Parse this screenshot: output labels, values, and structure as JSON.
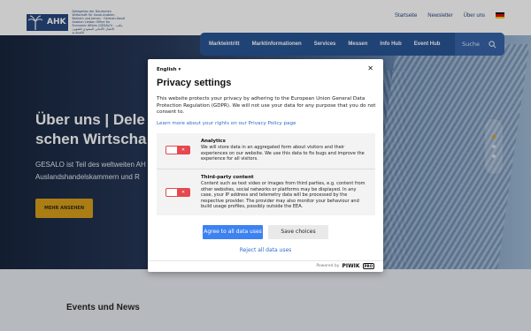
{
  "header": {
    "logo_abbr": "AHK",
    "logo_text": "Delegation der Deutschen Wirtschaft für Saudi-Arabien, Bahrain und Jemen · German-Saudi Arabian Liaison Office for Economic Affairs (GESALO) · مكتب الاتصال الألماني السعودي للشؤون الاقتصادية",
    "links": [
      "Startseite",
      "Newsletter",
      "Über uns"
    ],
    "flag_colors": [
      "#000000",
      "#dd0000",
      "#ffce00"
    ]
  },
  "nav": {
    "items": [
      "Markteintritt",
      "Marktinformationen",
      "Services",
      "Messen",
      "Info Hub",
      "Event Hub"
    ],
    "search_label": "Suche"
  },
  "hero": {
    "title_line1": "Über uns | Dele",
    "title_line2": "schen Wirtscha",
    "text_line1": "GESALO ist Teil des weltweiten AH",
    "text_line2": "Auslandshandelskammern und R",
    "button_label": "MEHR ANSEHEN"
  },
  "events_title": "Events und News",
  "modal": {
    "language": "English",
    "language_chevron": "▾",
    "close": "✕",
    "title": "Privacy settings",
    "description": "This website protects your privacy by adhering to the European Union General Data Protection Regulation (GDPR). We will not use your data for any purpose that you do not consent to.",
    "rights_link": "Learn more about your rights on our Privacy Policy page",
    "settings": [
      {
        "title": "Analytics",
        "text": "We will store data in an aggregated form about visitors and their experiences on our website. We use this data to fix bugs and improve the experience for all visitors.",
        "toggle": "✕"
      },
      {
        "title": "Third-party content",
        "text": "Content such as text video or images from third parties, e.g. content from other websites, social networks or platforms may be displayed. In any case, your IP address and telemetry data will be processed by the respective provider. The provider may also monitor your behaviour and build usage profiles, possibly outside the EEA.",
        "toggle": "✕"
      }
    ],
    "agree_button": "Agree to all data uses",
    "save_button": "Save choices",
    "reject_link": "Reject all data uses",
    "powered_by": "Powered by",
    "brand": "PIWIK",
    "brand_badge": "PRO"
  },
  "colors": {
    "brand_blue": "#1e4d91",
    "accent_gold": "#d69a0f",
    "primary_button": "#3d82f0",
    "toggle_red": "#e5484d",
    "link_blue": "#2e6cc9"
  }
}
